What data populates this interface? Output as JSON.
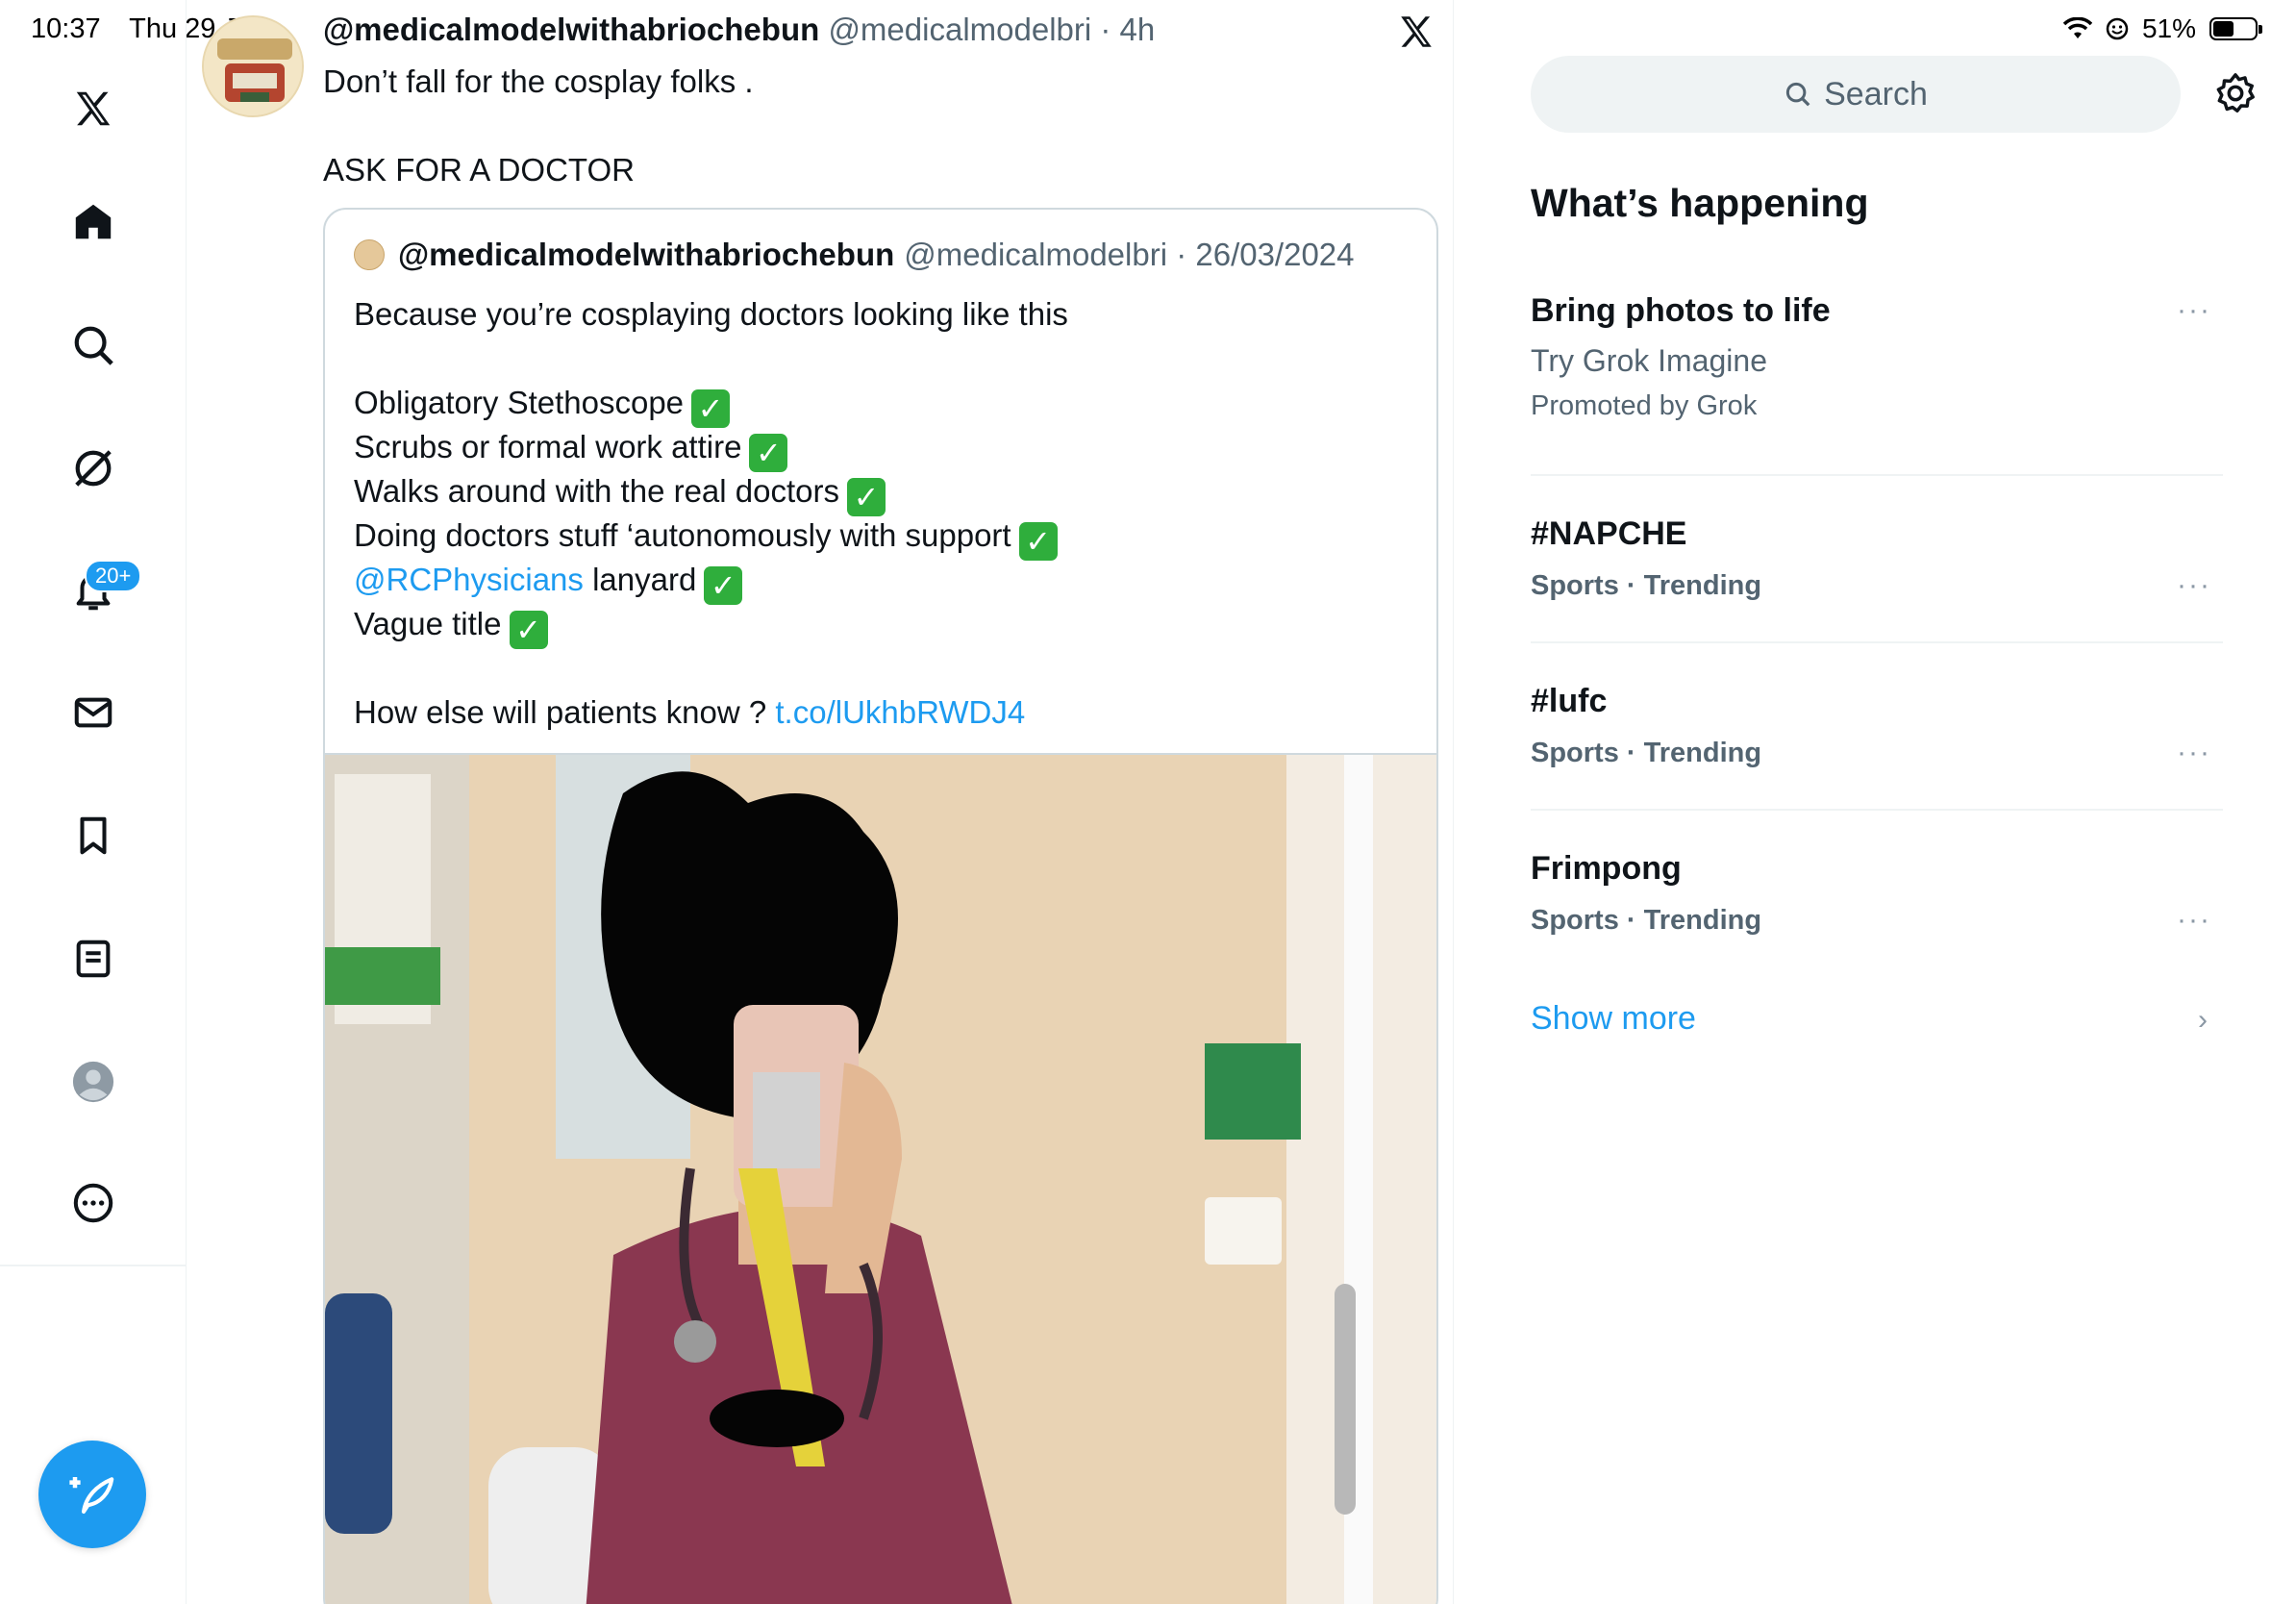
{
  "status_bar": {
    "time": "10:37",
    "date": "Thu 29 Jan",
    "battery": "51%",
    "battery_level": 0.51
  },
  "nav": {
    "items": [
      "x-logo",
      "home",
      "explore",
      "grok",
      "notifications",
      "messages",
      "bookmarks",
      "lists",
      "profile",
      "more"
    ],
    "notification_badge": "20+"
  },
  "tweet": {
    "display_name": "@medicalmodelwithabriochebun",
    "handle_time": "@medicalmodelbri · 4h",
    "text": "Don’t fall for the cosplay folks .\n\nASK FOR A DOCTOR"
  },
  "quote": {
    "display_name": "@medicalmodelwithabriochebun",
    "handle_date": "@medicalmodelbri · 26/03/2024",
    "line1": "Because you’re cosplaying doctors looking like this",
    "line2": "Obligatory Stethoscope",
    "line3": "Scrubs or formal work attire",
    "line4": "Walks around with the real doctors",
    "line5": "Doing doctors stuff ‘autonomously with support",
    "mention": "@RCPhysicians",
    "line6_rest": " lanyard",
    "line7": "Vague title",
    "line8": "How else will patients know ? ",
    "link": "t.co/lUkhbRWDJ4",
    "check": "✓"
  },
  "sidebar": {
    "search_placeholder": "Search",
    "trends_title": "What’s happening",
    "promo": {
      "title": "Bring photos to life",
      "subtitle": "Try Grok Imagine",
      "promoted": "Promoted by Grok"
    },
    "trends": [
      {
        "name": "#NAPCHE",
        "category": "Sports · Trending"
      },
      {
        "name": "#lufc",
        "category": "Sports · Trending"
      },
      {
        "name": "Frimpong",
        "category": "Sports · Trending"
      }
    ],
    "more_dots": "···",
    "show_more": "Show more",
    "chevron": "›"
  },
  "colors": {
    "accent": "#1d9bf0",
    "text": "#0f1419",
    "secondary": "#536471",
    "check_green": "#2fae3c"
  }
}
